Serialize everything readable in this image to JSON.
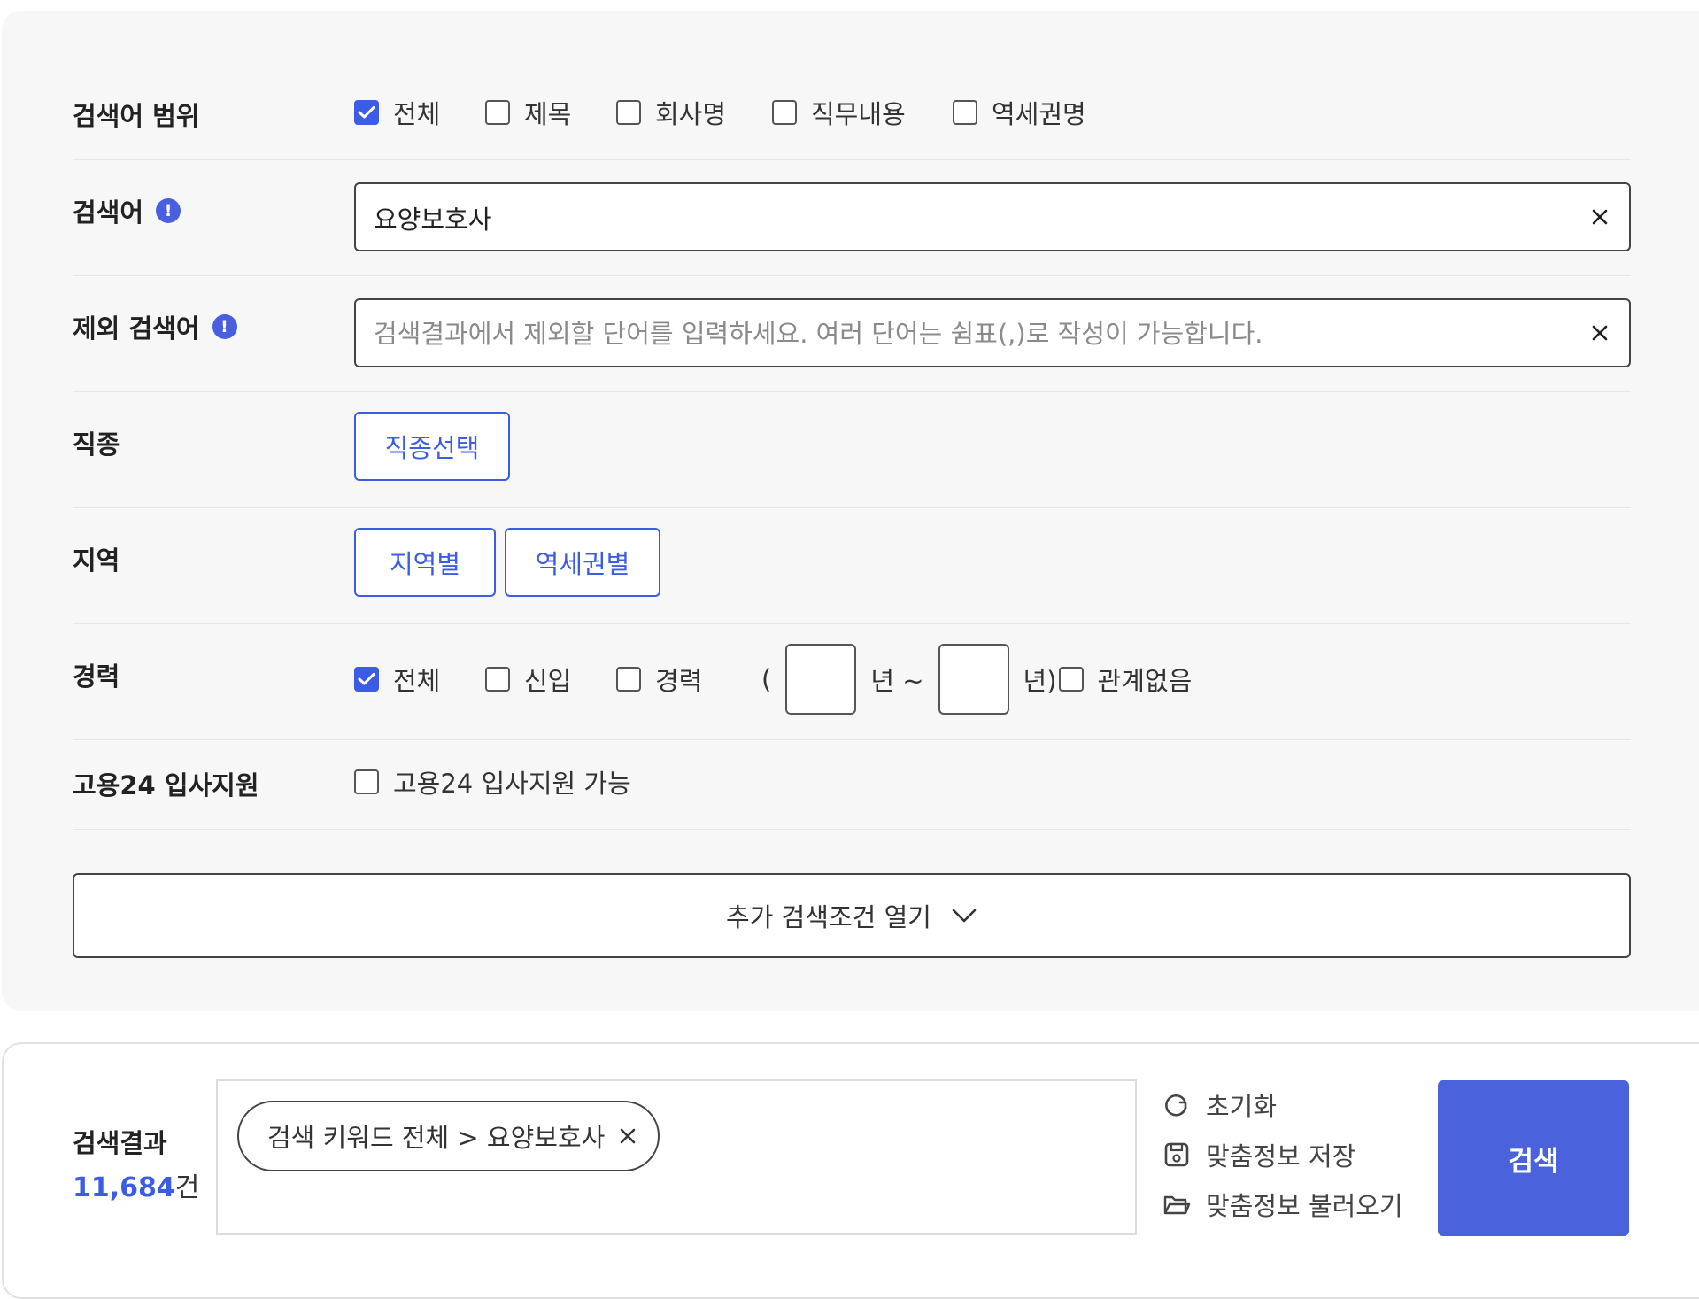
{
  "search_scope": {
    "label": "검색어 범위",
    "options": [
      {
        "label": "전체",
        "checked": true
      },
      {
        "label": "제목",
        "checked": false
      },
      {
        "label": "회사명",
        "checked": false
      },
      {
        "label": "직무내용",
        "checked": false
      },
      {
        "label": "역세권명",
        "checked": false
      }
    ]
  },
  "keyword": {
    "label": "검색어",
    "value": "요양보호사"
  },
  "exclude_keyword": {
    "label": "제외 검색어",
    "placeholder": "검색결과에서 제외할 단어를 입력하세요. 여러 단어는 쉼표(,)로 작성이 가능합니다."
  },
  "job_type": {
    "label": "직종",
    "button": "직종선택"
  },
  "region": {
    "label": "지역",
    "buttons": [
      "지역별",
      "역세권별"
    ]
  },
  "career": {
    "label": "경력",
    "options": [
      {
        "label": "전체",
        "checked": true
      },
      {
        "label": "신입",
        "checked": false
      },
      {
        "label": "경력",
        "checked": false
      }
    ],
    "open_paren": "(",
    "year_from_suffix": "년 ~",
    "year_to_suffix": "년)",
    "irrelevant": {
      "label": "관계없음",
      "checked": false
    }
  },
  "support24": {
    "label": "고용24 입사지원",
    "option": {
      "label": "고용24 입사지원 가능",
      "checked": false
    }
  },
  "more_conditions": {
    "label": "추가 검색조건 열기"
  },
  "results": {
    "label": "검색결과",
    "count": "11,684",
    "unit": "건",
    "tag": "검색 키워드 전체 > 요양보호사"
  },
  "actions": {
    "reset": "초기화",
    "save": "맞춤정보 저장",
    "load": "맞춤정보 불러오기"
  },
  "search_button": "검색",
  "colors": {
    "accent": "#3d5ce6",
    "search_button_bg": "#4a63dc",
    "panel_bg": "#f7f7f7"
  },
  "icons": [
    "info-icon",
    "close-icon",
    "checkmark-icon",
    "chevron-down-icon",
    "refresh-icon",
    "save-icon",
    "folder-open-icon"
  ]
}
